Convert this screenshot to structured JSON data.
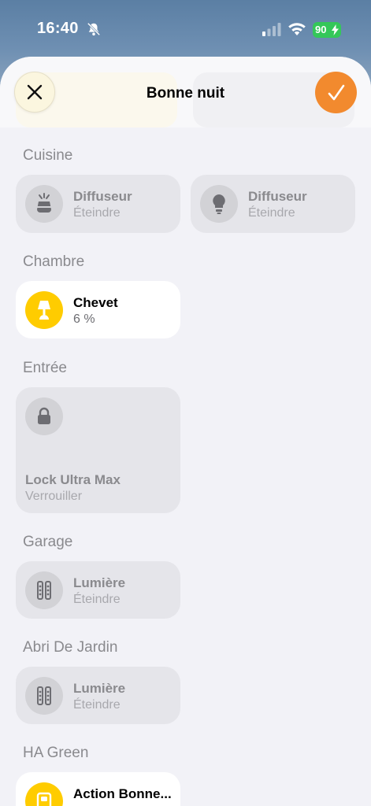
{
  "status_bar": {
    "time": "16:40",
    "battery": "90",
    "colors": {
      "battery": "#34c759"
    }
  },
  "sheet": {
    "title": "Bonne nuit",
    "close_icon": "close-icon",
    "confirm_icon": "checkmark-icon",
    "colors": {
      "confirm": "#f28a2e",
      "active_icon_bg": "#ffcc00"
    }
  },
  "sections": [
    {
      "label": "Cuisine",
      "tiles": [
        {
          "name": "Diffuseur",
          "state": "Éteindre",
          "icon": "diffuser-icon",
          "active": false
        },
        {
          "name": "Diffuseur",
          "state": "Éteindre",
          "icon": "lightbulb-icon",
          "active": false
        }
      ]
    },
    {
      "label": "Chambre",
      "tiles": [
        {
          "name": "Chevet",
          "state": "6 %",
          "icon": "table-lamp-icon",
          "active": true
        }
      ]
    },
    {
      "label": "Entrée",
      "tiles": [
        {
          "name": "Lock Ultra Max",
          "state": "Verrouiller",
          "icon": "lock-icon",
          "active": false
        }
      ]
    },
    {
      "label": "Garage",
      "tiles": [
        {
          "name": "Lumière",
          "state": "Éteindre",
          "icon": "light-strip-icon",
          "active": false
        }
      ]
    },
    {
      "label": "Abri De Jardin",
      "tiles": [
        {
          "name": "Lumière",
          "state": "Éteindre",
          "icon": "light-strip-icon",
          "active": false
        }
      ]
    },
    {
      "label": "HA Green",
      "tiles": [
        {
          "name": "Action Bonne...",
          "state": "",
          "icon": "switch-icon",
          "active": true
        }
      ]
    }
  ]
}
